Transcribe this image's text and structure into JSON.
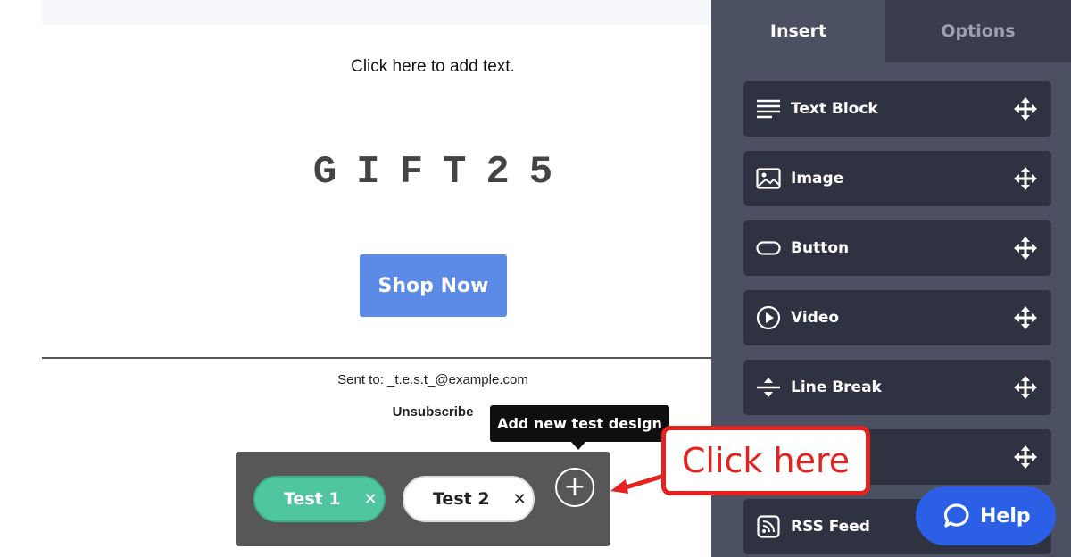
{
  "email": {
    "add_text_prompt": "Click here to add text.",
    "coupon_code": "GIFT25",
    "cta_label": "Shop Now",
    "sent_to": "Sent to: _t.e.s.t_@example.com",
    "unsubscribe_label": "Unsubscribe"
  },
  "test_bar": {
    "tests": [
      {
        "label": "Test 1",
        "remove": "✕"
      },
      {
        "label": "Test 2",
        "remove": "✕"
      }
    ],
    "add_symbol": "+",
    "add_tooltip": "Add new test design"
  },
  "sidebar": {
    "tabs": [
      {
        "label": "Insert",
        "active": true
      },
      {
        "label": "Options",
        "active": false
      }
    ],
    "blocks": [
      {
        "label": "Text Block",
        "icon": "text-lines-icon"
      },
      {
        "label": "Image",
        "icon": "image-icon"
      },
      {
        "label": "Button",
        "icon": "button-shape-icon"
      },
      {
        "label": "Video",
        "icon": "play-circle-icon"
      },
      {
        "label": "Line Break",
        "icon": "line-break-icon"
      },
      {
        "label": "",
        "icon": ""
      },
      {
        "label": "RSS Feed",
        "icon": "rss-icon"
      }
    ]
  },
  "annotation": {
    "callout_text": "Click here",
    "color": "#e4231f"
  },
  "help": {
    "label": "Help"
  },
  "colors": {
    "sidebar_bg": "#4c5063",
    "block_bg": "#2f3241",
    "test_active": "#4fc5a0",
    "cta_blue": "#5b8be6",
    "help_blue": "#2a5fe6"
  }
}
